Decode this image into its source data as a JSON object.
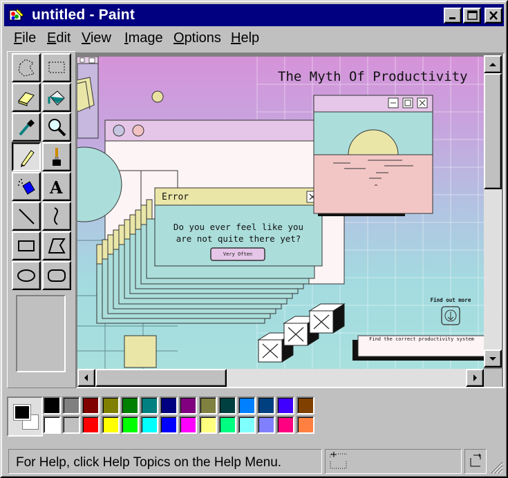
{
  "window": {
    "title": "untitled - Paint"
  },
  "menu": [
    {
      "label": "File",
      "underline": "F",
      "rest": "ile"
    },
    {
      "label": "Edit",
      "underline": "E",
      "rest": "dit"
    },
    {
      "label": "View",
      "underline": "V",
      "rest": "iew"
    },
    {
      "label": "Image",
      "underline": "I",
      "rest": "mage"
    },
    {
      "label": "Options",
      "underline": "O",
      "rest": "ptions"
    },
    {
      "label": "Help",
      "underline": "H",
      "rest": "elp"
    }
  ],
  "tools": [
    "free-form-select-tool",
    "select-tool",
    "eraser-tool",
    "fill-tool",
    "pick-color-tool",
    "magnifier-tool",
    "pencil-tool",
    "brush-tool",
    "airbrush-tool",
    "text-tool",
    "line-tool",
    "curve-tool",
    "rectangle-tool",
    "polygon-tool",
    "ellipse-tool",
    "rounded-rectangle-tool"
  ],
  "active_tool": "pencil-tool",
  "artwork": {
    "title": "The Myth Of Productivity",
    "error_title": "Error",
    "error_message_line1": "Do you ever feel like you",
    "error_message_line2": "are not quite there yet?",
    "error_button": "Very Often",
    "find_out_more": "Find out more",
    "find_system": "Find the correct productivity system"
  },
  "palette": {
    "foreground": "#000000",
    "background": "#ffffff",
    "top_row": [
      "#000000",
      "#808080",
      "#800000",
      "#808000",
      "#008000",
      "#008080",
      "#000080",
      "#800080",
      "#808040",
      "#004040",
      "#0080ff",
      "#004080",
      "#4000ff",
      "#804000"
    ],
    "bottom_row": [
      "#ffffff",
      "#c0c0c0",
      "#ff0000",
      "#ffff00",
      "#00ff00",
      "#00ffff",
      "#0000ff",
      "#ff00ff",
      "#ffff80",
      "#00ff80",
      "#80ffff",
      "#8080ff",
      "#ff0080",
      "#ff8040"
    ]
  },
  "status": {
    "help_text": "For Help, click Help Topics on the Help Menu."
  }
}
